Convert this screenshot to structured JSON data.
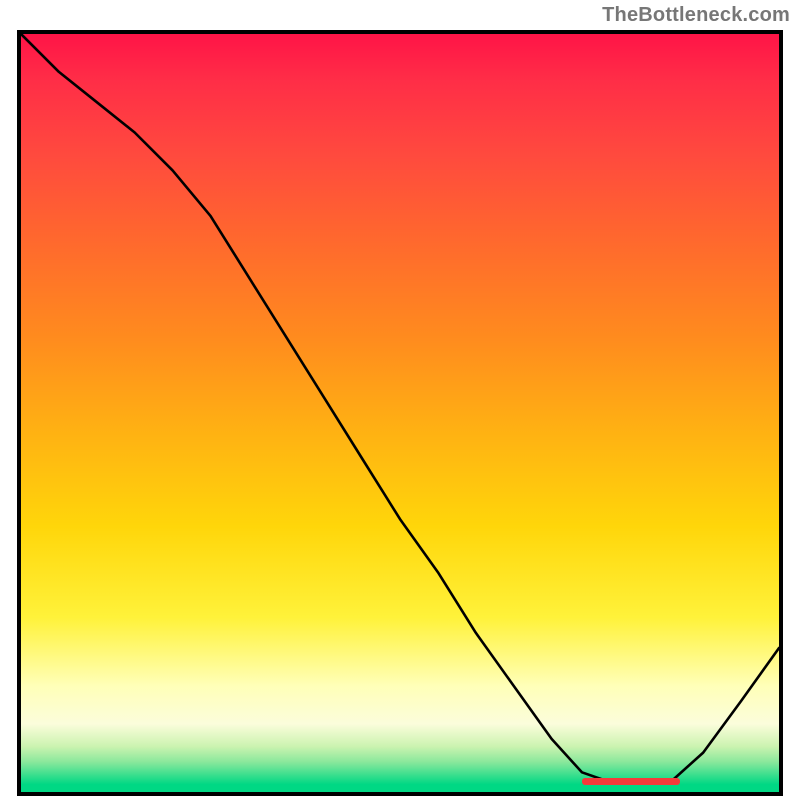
{
  "attribution": "TheBottleneck.com",
  "colors": {
    "frame": "#000000",
    "curve": "#000000",
    "marker": "#f43b3b",
    "gradient_top": "#ff1447",
    "gradient_bottom": "#00d884"
  },
  "chart_data": {
    "type": "line",
    "title": "",
    "xlabel": "",
    "ylabel": "",
    "xlim": [
      0,
      1
    ],
    "ylim": [
      0,
      1
    ],
    "x": [
      0.0,
      0.05,
      0.1,
      0.15,
      0.2,
      0.25,
      0.3,
      0.35,
      0.4,
      0.45,
      0.5,
      0.55,
      0.6,
      0.65,
      0.7,
      0.74,
      0.78,
      0.82,
      0.86,
      0.9,
      0.95,
      1.0
    ],
    "y": [
      1.0,
      0.95,
      0.91,
      0.87,
      0.82,
      0.76,
      0.68,
      0.6,
      0.52,
      0.44,
      0.36,
      0.29,
      0.21,
      0.14,
      0.07,
      0.026,
      0.012,
      0.012,
      0.016,
      0.052,
      0.12,
      0.19
    ],
    "optimum_range_x": [
      0.74,
      0.87
    ],
    "optimum_y": 0.014,
    "description": "Bottleneck percentage vs. component ratio. Background colored by bottleneck severity (top=worst red, bottom=best green). Black curve shows bottleneck; minimum marked in red near x≈0.74–0.87."
  }
}
